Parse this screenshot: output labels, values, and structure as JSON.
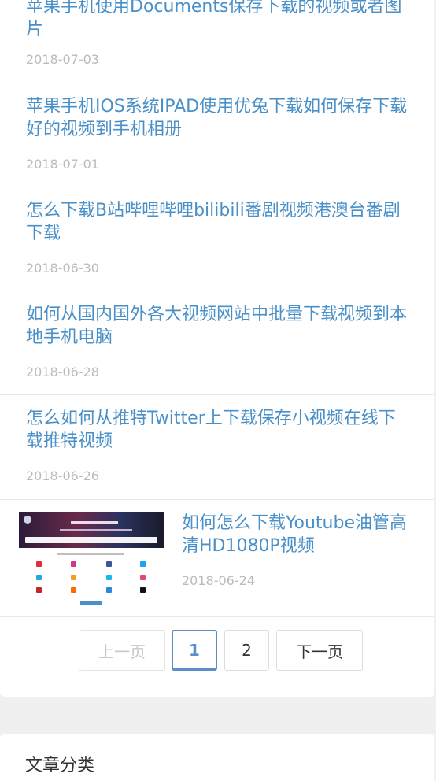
{
  "articles": [
    {
      "title": "苹果手机使用Documents保存下载的视频或者图片",
      "date": "2018-07-03"
    },
    {
      "title": "苹果手机IOS系统IPAD使用优兔下载如何保存下载好的视频到手机相册",
      "date": "2018-07-01"
    },
    {
      "title": "怎么下载B站哔哩哔哩bilibili番剧视频港澳台番剧下载",
      "date": "2018-06-30"
    },
    {
      "title": "如何从国内国外各大视频网站中批量下载视频到本地手机电脑",
      "date": "2018-06-28"
    },
    {
      "title": "怎么如何从推特Twitter上下载保存小视频在线下载推特视频",
      "date": "2018-06-26"
    },
    {
      "title": "如何怎么下载Youtube油管高清HD1080P视频",
      "date": "2018-06-24"
    }
  ],
  "pagination": {
    "prev": "上一页",
    "page1": "1",
    "page2": "2",
    "next": "下一页"
  },
  "sidebar": {
    "heading": "文章分类"
  },
  "colors": {
    "link": "#4a90c8",
    "date": "#bbbbbb",
    "active_page": "#5b8fc7"
  }
}
